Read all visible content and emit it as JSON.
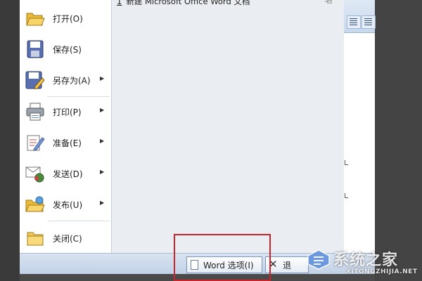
{
  "office_menu": {
    "items": [
      {
        "label": "打开(O)",
        "icon": "open-folder-icon"
      },
      {
        "label": "保存(S)",
        "icon": "save-disk-icon"
      },
      {
        "label": "另存为(A)",
        "icon": "save-as-icon",
        "has_submenu": true
      },
      {
        "label": "打印(P)",
        "icon": "printer-icon",
        "has_submenu": true
      },
      {
        "label": "准备(E)",
        "icon": "prepare-pen-icon",
        "has_submenu": true
      },
      {
        "label": "发送(D)",
        "icon": "send-mail-icon",
        "has_submenu": true
      },
      {
        "label": "发布(U)",
        "icon": "publish-folder-icon",
        "has_submenu": true
      },
      {
        "label": "关闭(C)",
        "icon": "close-folder-icon"
      }
    ],
    "recent_documents": [
      {
        "number": "1",
        "name": "新建 Microsoft Office Word 文档"
      }
    ],
    "word_options_label": "Word 选项(I)",
    "exit_label": "退"
  },
  "watermark": {
    "text": "系统之家",
    "url": "XITONGZHIJIA.NET"
  },
  "colors": {
    "menu_bg": "#ffffff",
    "recent_pane_bg": "#eaedf1",
    "bottom_bar": "#c9d7ea",
    "highlight_border": "#c8242a"
  }
}
